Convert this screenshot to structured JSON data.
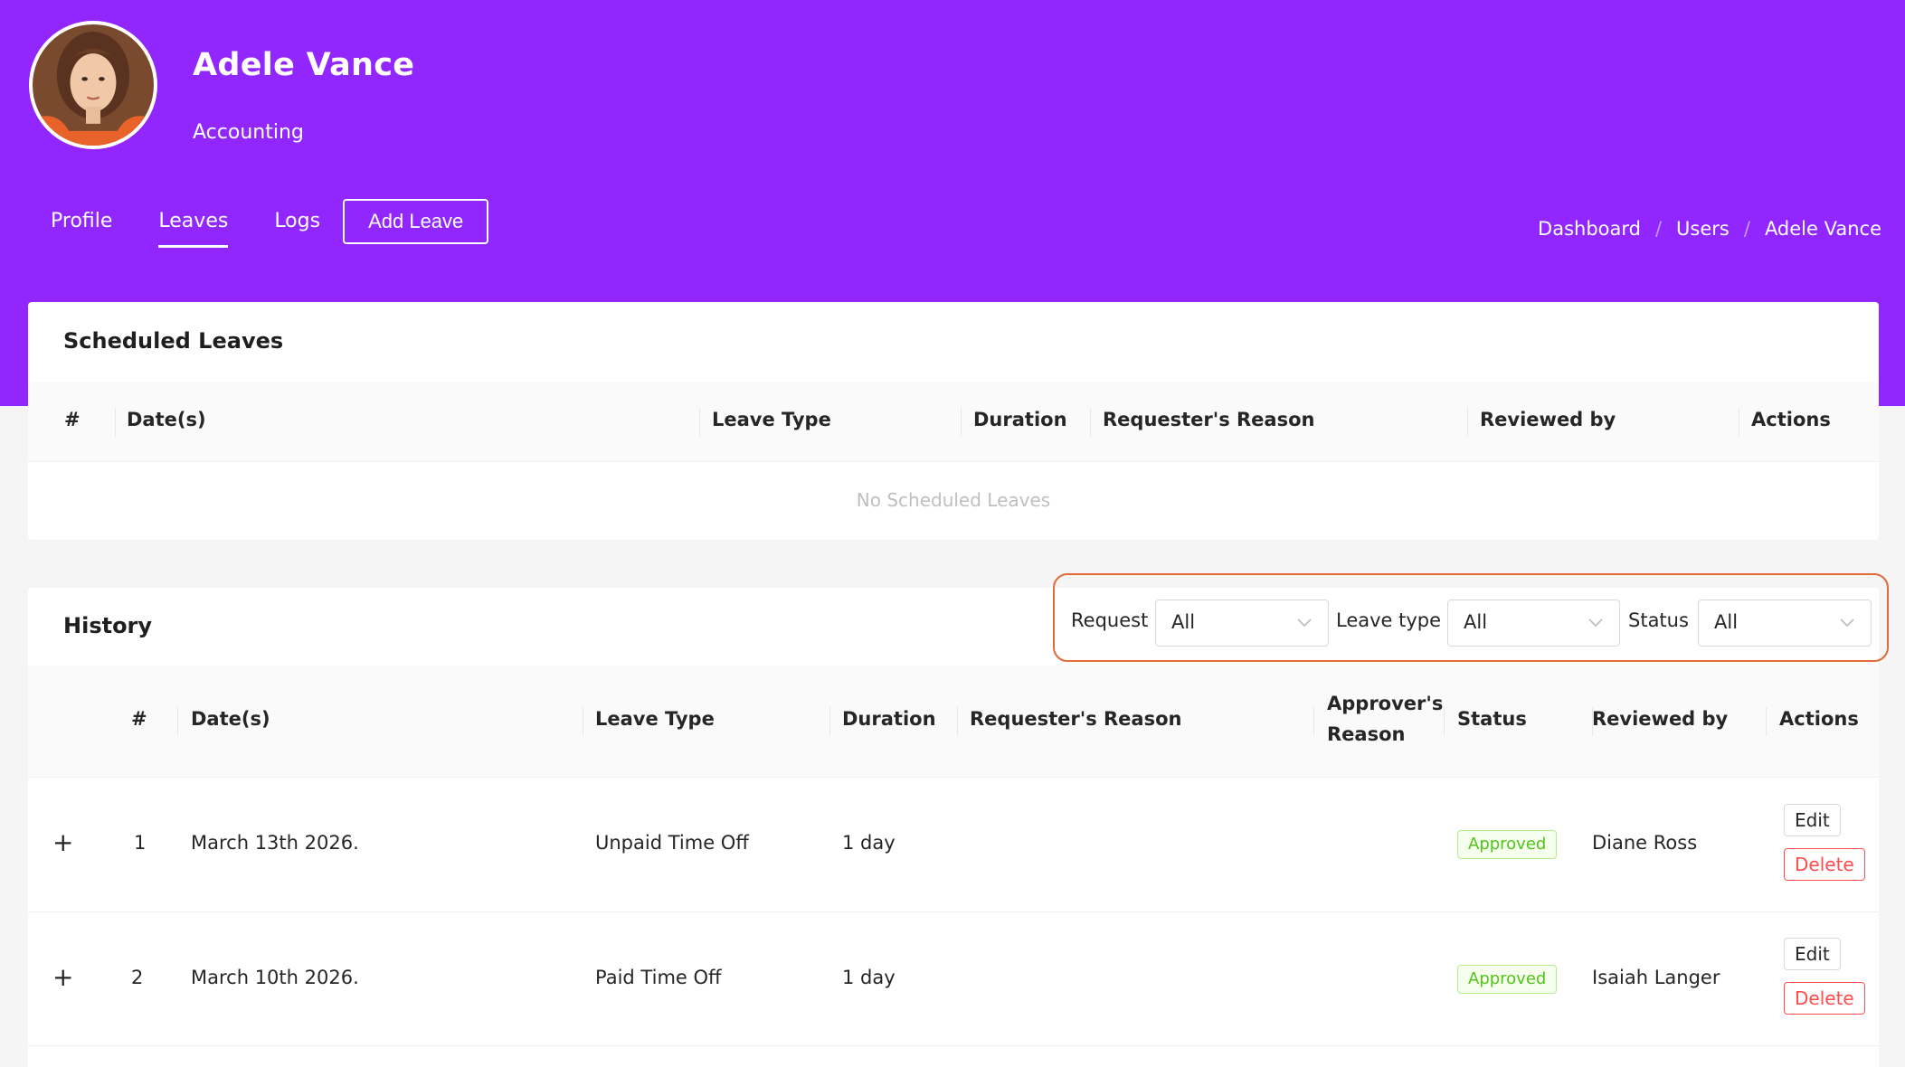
{
  "user": {
    "name": "Adele Vance",
    "department": "Accounting"
  },
  "nav": {
    "tabs": [
      {
        "label": "Profile"
      },
      {
        "label": "Leaves",
        "active": true
      },
      {
        "label": "Logs"
      }
    ],
    "add_leave_label": "Add Leave"
  },
  "breadcrumb": [
    "Dashboard",
    "Users",
    "Adele Vance"
  ],
  "breadcrumb_separator": "/",
  "scheduled": {
    "title": "Scheduled Leaves",
    "columns": [
      "#",
      "Date(s)",
      "Leave Type",
      "Duration",
      "Requester's Reason",
      "Reviewed by",
      "Actions"
    ],
    "empty_text": "No Scheduled Leaves"
  },
  "history": {
    "title": "History",
    "filters": [
      {
        "label": "Request",
        "value": "All"
      },
      {
        "label": "Leave type",
        "value": "All"
      },
      {
        "label": "Status",
        "value": "All"
      }
    ],
    "columns": [
      "#",
      "Date(s)",
      "Leave Type",
      "Duration",
      "Requester's Reason",
      "Approver's",
      "Reason",
      "Status",
      "Reviewed by",
      "Actions"
    ],
    "rows": [
      {
        "num": "1",
        "dates": "March 13th 2026.",
        "leave_type": "Unpaid Time Off",
        "duration": "1 day",
        "requester_reason": "",
        "approver_reason": "",
        "status": "Approved",
        "reviewed_by": "Diane Ross"
      },
      {
        "num": "2",
        "dates": "March 10th 2026.",
        "leave_type": "Paid Time Off",
        "duration": "1 day",
        "requester_reason": "",
        "approver_reason": "",
        "status": "Approved",
        "reviewed_by": "Isaiah Langer"
      }
    ],
    "expand_symbol": "+",
    "edit_label": "Edit",
    "delete_label": "Delete"
  },
  "colors": {
    "brand": "#9226ff",
    "filter_highlight": "#e06a3a",
    "approved": "#52c41a",
    "danger": "#ff4d4f"
  }
}
